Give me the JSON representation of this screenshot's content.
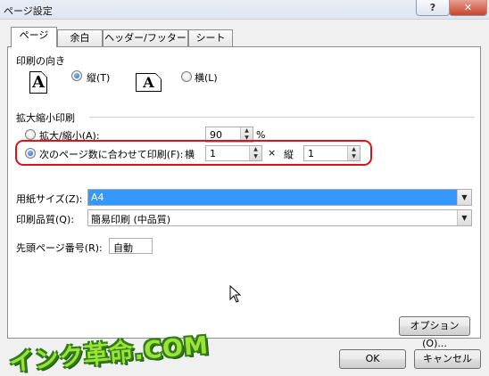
{
  "window": {
    "title": "ページ設定",
    "help_label": "?",
    "close_label": "✕"
  },
  "tabs": [
    {
      "label": "ページ",
      "active": true
    },
    {
      "label": "余白",
      "active": false
    },
    {
      "label": "ヘッダー/フッター",
      "active": false
    },
    {
      "label": "シート",
      "active": false
    }
  ],
  "orientation": {
    "heading": "印刷の向き",
    "portrait_label": "縦(T)",
    "landscape_label": "横(L)",
    "icon_letter": "A",
    "selected": "portrait"
  },
  "scaling": {
    "heading": "拡大縮小印刷",
    "scale_label": "拡大/縮小(A):",
    "scale_value": "90",
    "scale_unit": "%",
    "fit_label": "次のページ数に合わせて印刷(F):",
    "wide_label": "横",
    "wide_value": "1",
    "times_symbol": "×",
    "tall_label": "縦",
    "tall_value": "1",
    "selected": "fit"
  },
  "paper": {
    "size_label": "用紙サイズ(Z):",
    "size_value": "A4",
    "quality_label": "印刷品質(Q):",
    "quality_value": "簡易印刷 (中品質)",
    "first_page_label": "先頭ページ番号(R):",
    "first_page_value": "自動"
  },
  "buttons": {
    "options": "オプション(O)...",
    "ok": "OK",
    "cancel": "キャンセル"
  },
  "watermark": "インク革命.COM",
  "colors": {
    "highlight": "#e0111a",
    "selection": "#3399ff",
    "watermark": "#9be33a"
  }
}
